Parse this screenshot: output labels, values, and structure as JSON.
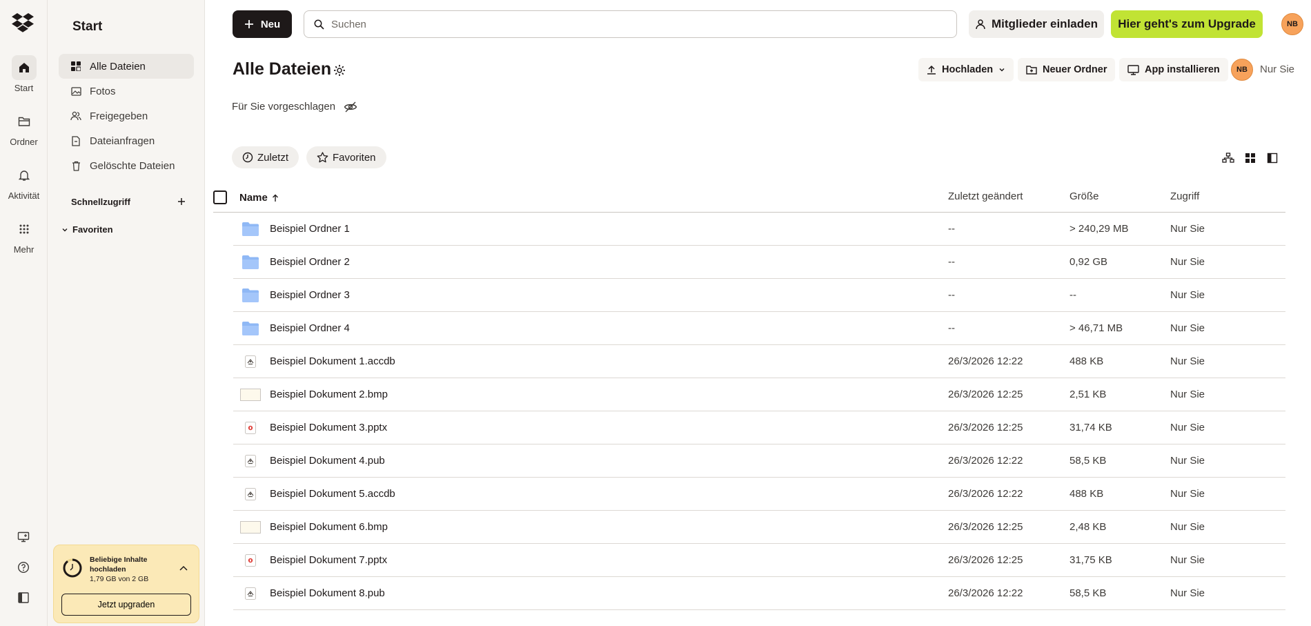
{
  "rail": {
    "items": [
      {
        "label": "Start",
        "icon": "home-icon"
      },
      {
        "label": "Ordner",
        "icon": "folder-icon"
      },
      {
        "label": "Aktivität",
        "icon": "bell-icon"
      },
      {
        "label": "Mehr",
        "icon": "grid-icon"
      }
    ]
  },
  "sidebar": {
    "title": "Start",
    "items": [
      {
        "label": "Alle Dateien",
        "icon": "all-files-icon"
      },
      {
        "label": "Fotos",
        "icon": "photo-icon"
      },
      {
        "label": "Freigegeben",
        "icon": "shared-icon"
      },
      {
        "label": "Dateianfragen",
        "icon": "file-request-icon"
      },
      {
        "label": "Gelöschte Dateien",
        "icon": "trash-icon"
      }
    ],
    "quick_access_label": "Schnellzugriff",
    "favorites_label": "Favoriten"
  },
  "promo": {
    "line1": "Beliebige Inhalte hochladen",
    "line2": "1,79 GB von 2 GB",
    "button": "Jetzt upgraden",
    "storage_used_fraction": 0.895
  },
  "topbar": {
    "new_label": "Neu",
    "search_placeholder": "Suchen",
    "invite_label": "Mitglieder einladen",
    "upgrade_label": "Hier geht's zum Upgrade",
    "avatar_initials": "NB"
  },
  "header": {
    "title": "Alle Dateien",
    "upload_label": "Hochladen",
    "new_folder_label": "Neuer Ordner",
    "install_app_label": "App installieren",
    "avatar_initials": "NB",
    "owner_label": "Nur Sie"
  },
  "suggested": {
    "label": "Für Sie vorgeschlagen"
  },
  "filters": {
    "recent": "Zuletzt",
    "favorites": "Favoriten"
  },
  "table": {
    "columns": {
      "name": "Name",
      "modified": "Zuletzt geändert",
      "size": "Größe",
      "access": "Zugriff"
    },
    "rows": [
      {
        "name": "Beispiel Ordner 1",
        "modified": "--",
        "size": "> 240,29 MB",
        "access": "Nur Sie",
        "type": "folder"
      },
      {
        "name": "Beispiel Ordner 2",
        "modified": "--",
        "size": "0,92 GB",
        "access": "Nur Sie",
        "type": "folder"
      },
      {
        "name": "Beispiel Ordner 3",
        "modified": "--",
        "size": "--",
        "access": "Nur Sie",
        "type": "folder"
      },
      {
        "name": "Beispiel Ordner 4",
        "modified": "--",
        "size": "> 46,71 MB",
        "access": "Nur Sie",
        "type": "folder"
      },
      {
        "name": "Beispiel Dokument 1.accdb",
        "modified": "26/3/2026 12:22",
        "size": "488 KB",
        "access": "Nur Sie",
        "type": "generic"
      },
      {
        "name": "Beispiel Dokument 2.bmp",
        "modified": "26/3/2026 12:25",
        "size": "2,51 KB",
        "access": "Nur Sie",
        "type": "image"
      },
      {
        "name": "Beispiel Dokument 3.pptx",
        "modified": "26/3/2026 12:25",
        "size": "31,74 KB",
        "access": "Nur Sie",
        "type": "pptx"
      },
      {
        "name": "Beispiel Dokument 4.pub",
        "modified": "26/3/2026 12:22",
        "size": "58,5 KB",
        "access": "Nur Sie",
        "type": "generic"
      },
      {
        "name": "Beispiel Dokument 5.accdb",
        "modified": "26/3/2026 12:22",
        "size": "488 KB",
        "access": "Nur Sie",
        "type": "generic"
      },
      {
        "name": "Beispiel Dokument 6.bmp",
        "modified": "26/3/2026 12:25",
        "size": "2,48 KB",
        "access": "Nur Sie",
        "type": "image"
      },
      {
        "name": "Beispiel Dokument 7.pptx",
        "modified": "26/3/2026 12:25",
        "size": "31,75 KB",
        "access": "Nur Sie",
        "type": "pptx"
      },
      {
        "name": "Beispiel Dokument 8.pub",
        "modified": "26/3/2026 12:22",
        "size": "58,5 KB",
        "access": "Nur Sie",
        "type": "generic"
      }
    ]
  },
  "colors": {
    "upgrade": "#c1e334",
    "avatar": "#f7a25b",
    "folder": "#8fb8f5",
    "promo": "#fbe9b7"
  }
}
